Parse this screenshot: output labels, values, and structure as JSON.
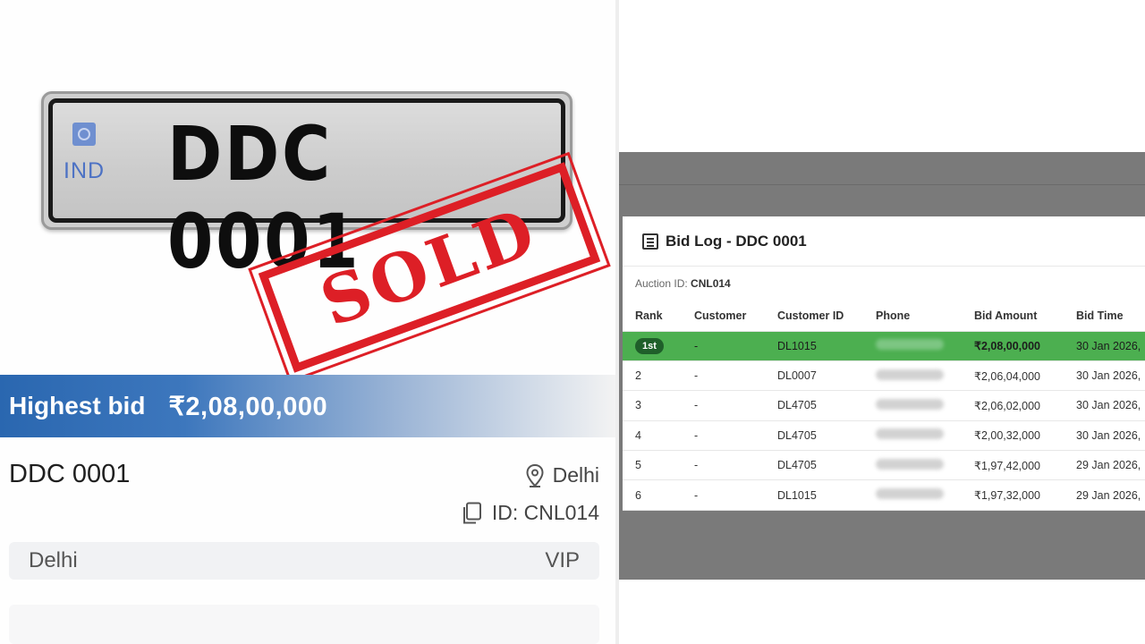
{
  "plate": {
    "country": "IND",
    "number": "DDC 0001"
  },
  "stamp": {
    "text": "SOLD",
    "color": "#dd1f26"
  },
  "listing": {
    "highest_bid_label": "Highest bid",
    "highest_bid_value": "₹2,08,00,000",
    "title": "DDC 0001",
    "location": "Delhi",
    "id_text": "ID: CNL014",
    "tag_left": "Delhi",
    "tag_right": "VIP"
  },
  "bid_log": {
    "title": "Bid Log - DDC 0001",
    "auction_label": "Auction ID:",
    "auction_id": "CNL014",
    "columns": [
      "Rank",
      "Customer",
      "Customer ID",
      "Phone",
      "Bid Amount",
      "Bid Time"
    ],
    "rows": [
      {
        "rank": "1st",
        "customer": "-",
        "customer_id": "DL1015",
        "amount": "₹2,08,00,000",
        "time": "30 Jan 2026,"
      },
      {
        "rank": "2",
        "customer": "-",
        "customer_id": "DL0007",
        "amount": "₹2,06,04,000",
        "time": "30 Jan 2026,"
      },
      {
        "rank": "3",
        "customer": "-",
        "customer_id": "DL4705",
        "amount": "₹2,06,02,000",
        "time": "30 Jan 2026,"
      },
      {
        "rank": "4",
        "customer": "-",
        "customer_id": "DL4705",
        "amount": "₹2,00,32,000",
        "time": "30 Jan 2026,"
      },
      {
        "rank": "5",
        "customer": "-",
        "customer_id": "DL4705",
        "amount": "₹1,97,42,000",
        "time": "29 Jan 2026,"
      },
      {
        "rank": "6",
        "customer": "-",
        "customer_id": "DL1015",
        "amount": "₹1,97,32,000",
        "time": "29 Jan 2026,"
      }
    ]
  },
  "colors": {
    "winner_row": "#4caf50",
    "banner_blue": "#2a67b0",
    "backdrop": "#7a7a7a"
  },
  "icons": [
    "location-pin-icon",
    "copy-id-icon",
    "list-icon"
  ]
}
